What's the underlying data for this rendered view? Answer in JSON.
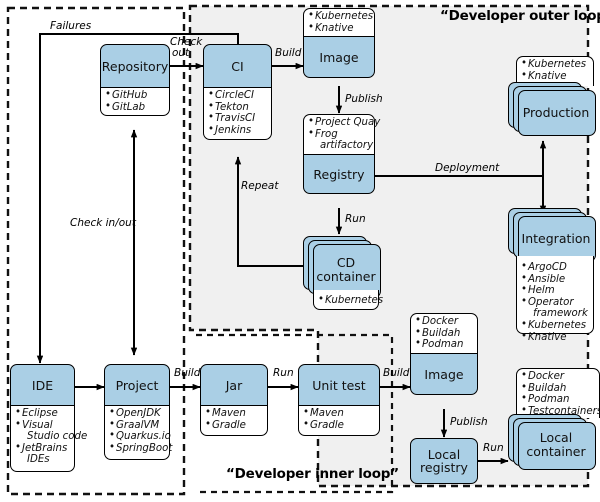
{
  "diagram": {
    "title_outer": "“Developer outer loop”",
    "title_inner": "“Developer inner loop”"
  },
  "nodes": {
    "repository": {
      "label": "Repository",
      "tools": [
        "GitHub",
        "GitLab"
      ]
    },
    "ci": {
      "label": "CI",
      "tools": [
        "CircleCI",
        "Tekton",
        "TravisCI",
        "Jenkins"
      ]
    },
    "image_outer": {
      "label": "Image",
      "tools": [
        "Kubernetes",
        "Knative"
      ]
    },
    "registry": {
      "label": "Registry",
      "tools": [
        "Project Quay",
        "Frog",
        "artifactory"
      ]
    },
    "cd_container": {
      "label": "CD\ncontainer",
      "label_line1": "CD",
      "label_line2": "container",
      "tools": [
        "Kubernetes"
      ]
    },
    "production": {
      "label": "Production",
      "tools": [
        "Kubernetes",
        "Knative"
      ]
    },
    "integration": {
      "label": "Integration",
      "tools": [
        "ArgoCD",
        "Ansible",
        "Helm",
        "Operator",
        "framework",
        "Kubernetes",
        "Knative"
      ]
    },
    "ide": {
      "label": "IDE",
      "tools": [
        "Eclipse",
        "Visual",
        "Studio code",
        "JetBrains",
        "IDEs"
      ]
    },
    "project": {
      "label": "Project",
      "tools": [
        "OpenJDK",
        "GraalVM",
        "Quarkus.io",
        "SpringBoot"
      ]
    },
    "jar": {
      "label": "Jar",
      "tools": [
        "Maven",
        "Gradle"
      ]
    },
    "unit_test": {
      "label": "Unit test",
      "tools": [
        "Maven",
        "Gradle"
      ]
    },
    "image_inner": {
      "label": "Image",
      "tools": [
        "Docker",
        "Buildah",
        "Podman"
      ]
    },
    "local_registry": {
      "label_line1": "Local",
      "label_line2": "registry"
    },
    "local_container": {
      "label_line1": "Local",
      "label_line2": "container",
      "tools": [
        "Docker",
        "Buildah",
        "Podman",
        "Testcontainers"
      ]
    }
  },
  "edges": {
    "failures": "Failures",
    "check_out_l1": "Check",
    "check_out_l2": "out",
    "build_ci": "Build",
    "publish_outer": "Publish",
    "repeat": "Repeat",
    "run_outer": "Run",
    "deployment": "Deployment",
    "check_in_out": "Check in/out",
    "build_project": "Build",
    "run_jar": "Run",
    "build_unit": "Build",
    "publish_inner": "Publish",
    "run_local": "Run"
  },
  "colors": {
    "node_fill": "#aacfe5",
    "panel_fill": "#f0f0f0",
    "stroke": "#000000",
    "page_bg": "#ffffff"
  }
}
